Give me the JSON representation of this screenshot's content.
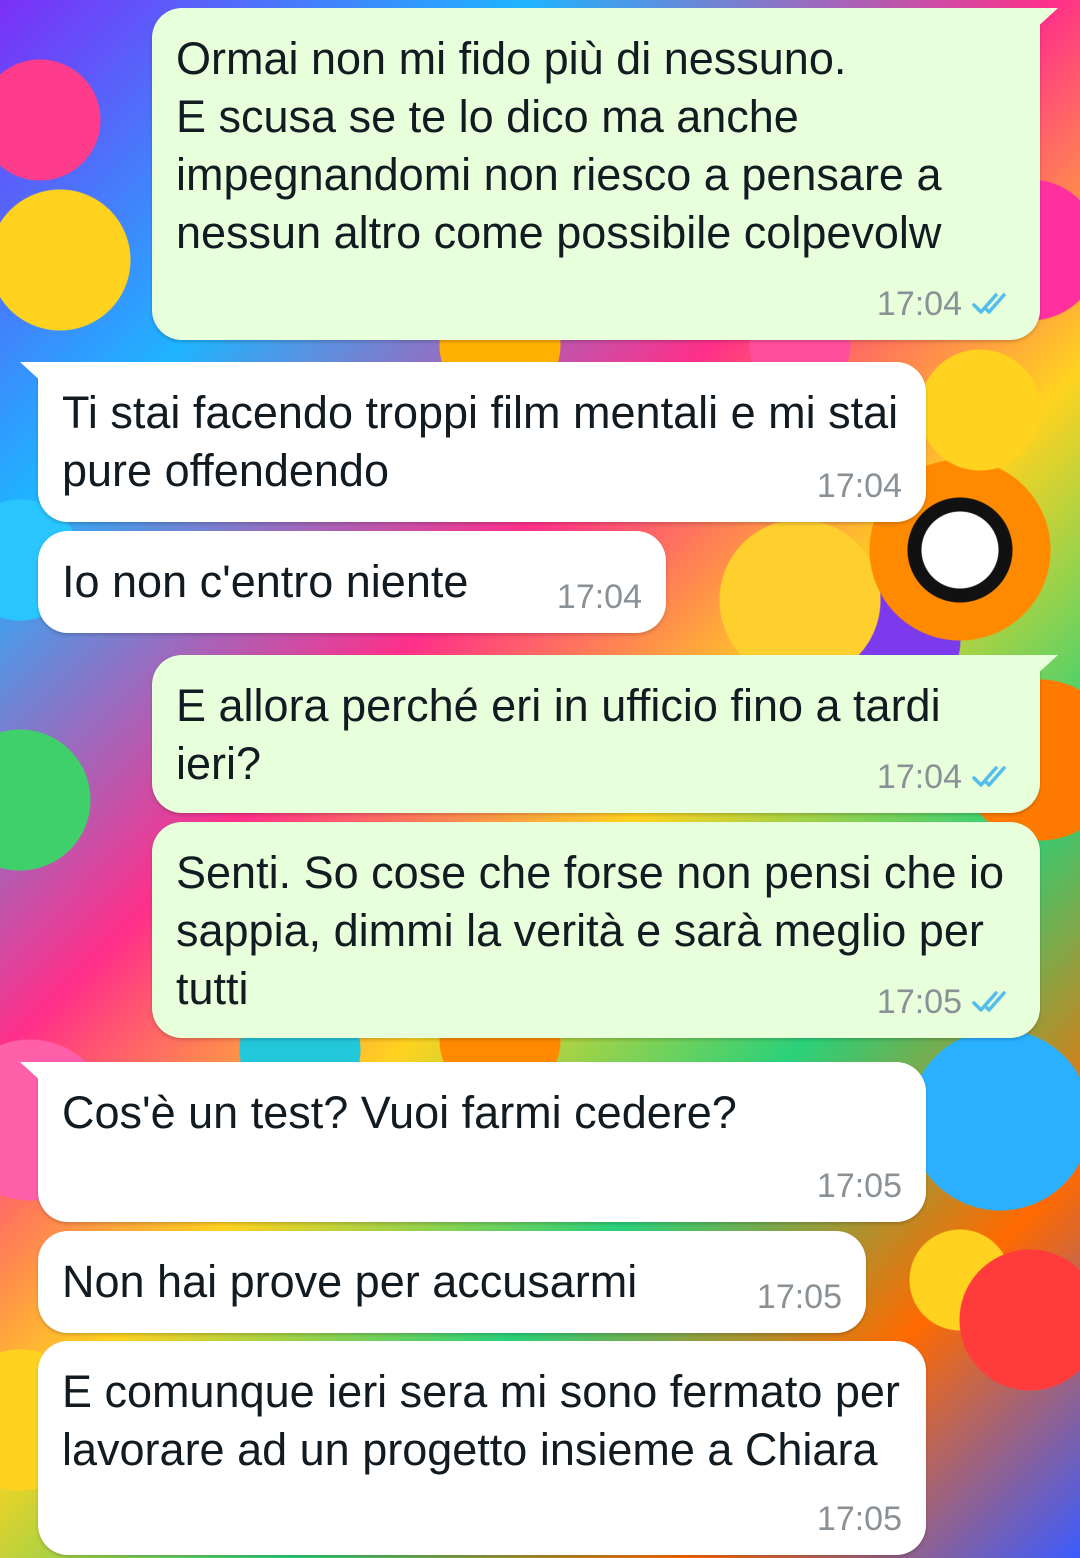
{
  "colors": {
    "outgoing_bubble": "#e7ffdb",
    "incoming_bubble": "#ffffff",
    "read_ticks": "#53bdeb",
    "timestamp": "#8a9196"
  },
  "messages": [
    {
      "direction": "out",
      "text": "Ormai non mi fido più di nessuno.\nE scusa se te lo dico ma anche impegnandomi non riesco a pensare a nessun altro come possibile colpevolw",
      "time": "17:04",
      "status_icon": "double-check-read-icon"
    },
    {
      "direction": "in",
      "text": "Ti stai facendo troppi film mentali e mi stai pure offendendo",
      "time": "17:04"
    },
    {
      "direction": "in",
      "text": "Io non c'entro niente",
      "time": "17:04"
    },
    {
      "direction": "out",
      "text": "E allora perché eri in ufficio fino a tardi ieri?",
      "time": "17:04",
      "status_icon": "double-check-read-icon"
    },
    {
      "direction": "out",
      "text": "Senti. So cose che forse non pensi che io sappia, dimmi la verità e sarà meglio per tutti",
      "time": "17:05",
      "status_icon": "double-check-read-icon"
    },
    {
      "direction": "in",
      "text": "Cos'è un test? Vuoi farmi cedere?",
      "time": "17:05"
    },
    {
      "direction": "in",
      "text": "Non hai prove per accusarmi",
      "time": "17:05"
    },
    {
      "direction": "in",
      "text": "E comunque ieri sera mi sono fermato per lavorare ad un progetto insieme a Chiara",
      "time": "17:05"
    }
  ]
}
